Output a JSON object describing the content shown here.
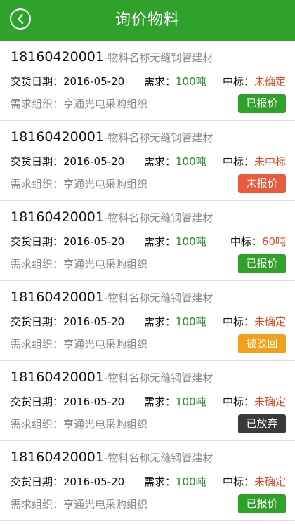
{
  "header": {
    "title": "询价物料"
  },
  "labels": {
    "date": "交货日期：",
    "need": "需求：",
    "bid": "中标：",
    "org": "需求组织："
  },
  "items": [
    {
      "code": "18160420001",
      "name": "-物料名称无缝钢管建材",
      "date": "2016-05-20",
      "need": "100吨",
      "bid": "未确定",
      "org": "亨通光电采购组织",
      "status": "已报价"
    },
    {
      "code": "18160420001",
      "name": "-物料名称无缝钢管建材",
      "date": "2016-05-20",
      "need": "100吨",
      "bid": "未中标",
      "org": "亨通光电采购组织",
      "status": "未报价"
    },
    {
      "code": "18160420001",
      "name": "-物料名称无缝钢管建材",
      "date": "2016-05-20",
      "need": "100吨",
      "bid": "60吨",
      "org": "亨通光电采购组织",
      "status": "已报价"
    },
    {
      "code": "18160420001",
      "name": "-物料名称无缝钢管建材",
      "date": "2016-05-20",
      "need": "100吨",
      "bid": "未确定",
      "org": "亨通光电采购组织",
      "status": "被驳回"
    },
    {
      "code": "18160420001",
      "name": "-物料名称无缝钢管建材",
      "date": "2016-05-20",
      "need": "100吨",
      "bid": "未确定",
      "org": "亨通光电采购组织",
      "status": "已放弃"
    },
    {
      "code": "18160420001",
      "name": "-物料名称无缝钢管建材",
      "date": "2016-05-20",
      "need": "100吨",
      "bid": "未确定",
      "org": "亨通光电采购组织",
      "status": "已报价"
    }
  ],
  "colors": {
    "header": "#2ea22a",
    "green_text": "#2b8a2b",
    "red_text": "#e04a2a",
    "status_quoted": "#2ea22a",
    "status_unquoted": "#ea5a3c",
    "status_rejected": "#f0a01a",
    "status_abandoned": "#3a3a3a"
  },
  "icons": {
    "back": "back-arrow-icon"
  }
}
